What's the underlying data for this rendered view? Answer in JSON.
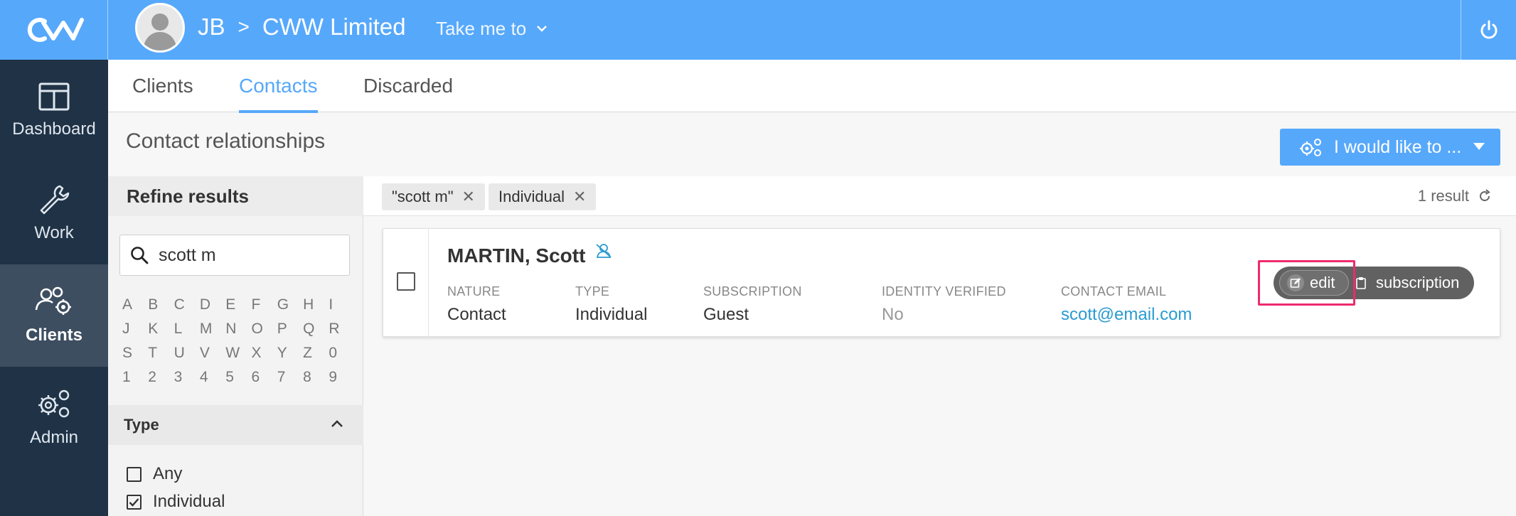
{
  "header": {
    "user_initials": "JB",
    "separator": ">",
    "company": "CWW Limited",
    "take_me_to": "Take me to"
  },
  "sidebar": {
    "items": [
      {
        "label": "Dashboard",
        "icon": "dashboard-icon"
      },
      {
        "label": "Work",
        "icon": "wrench-icon"
      },
      {
        "label": "Clients",
        "icon": "clients-icon",
        "active": true
      },
      {
        "label": "Admin",
        "icon": "gears-icon"
      }
    ]
  },
  "tabs": [
    {
      "label": "Clients"
    },
    {
      "label": "Contacts",
      "active": true
    },
    {
      "label": "Discarded"
    }
  ],
  "page": {
    "title": "Contact relationships",
    "action_button": "I would like to ..."
  },
  "refine": {
    "heading": "Refine results",
    "search_value": "scott m",
    "alphabet": [
      "A",
      "B",
      "C",
      "D",
      "E",
      "F",
      "G",
      "H",
      "I",
      "J",
      "K",
      "L",
      "M",
      "N",
      "O",
      "P",
      "Q",
      "R",
      "S",
      "T",
      "U",
      "V",
      "W",
      "X",
      "Y",
      "Z",
      "0",
      "1",
      "2",
      "3",
      "4",
      "5",
      "6",
      "7",
      "8",
      "9"
    ],
    "type_heading": "Type",
    "type_options": [
      {
        "label": "Any",
        "checked": false
      },
      {
        "label": "Individual",
        "checked": true
      }
    ]
  },
  "filters": {
    "chips": [
      "\"scott m\"",
      "Individual"
    ],
    "result_count": "1 result"
  },
  "result": {
    "name": "MARTIN, Scott",
    "fields": [
      {
        "key": "NATURE",
        "value": "Contact"
      },
      {
        "key": "TYPE",
        "value": "Individual"
      },
      {
        "key": "SUBSCRIPTION",
        "value": "Guest"
      },
      {
        "key": "IDENTITY VERIFIED",
        "value": "No"
      },
      {
        "key": "CONTACT EMAIL",
        "value": "scott@email.com"
      }
    ],
    "edit_label": "edit",
    "subscription_label": "subscription"
  },
  "colors": {
    "primary": "#56a8fb",
    "sidebar": "#1f3246",
    "highlight": "#ee2a6f",
    "link": "#2a9bd0"
  }
}
